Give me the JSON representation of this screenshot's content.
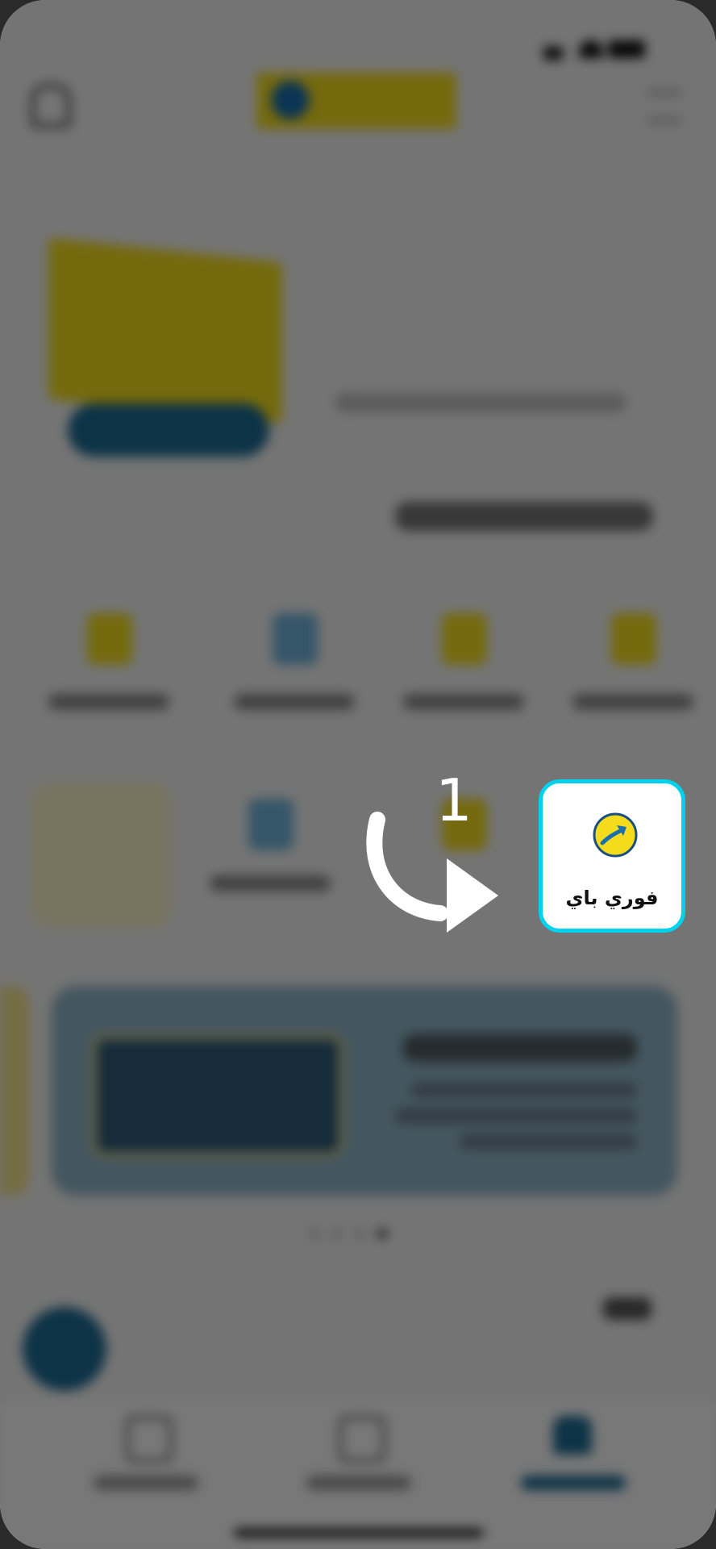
{
  "highlight": {
    "label": "فوري باي",
    "border_color": "#00d2ee",
    "icon": "fawry-pay-icon"
  },
  "step": {
    "number": "1",
    "icon": "curved-arrow-icon"
  },
  "colors": {
    "brand_yellow": "#f4dc1c",
    "brand_blue": "#1c6b93",
    "overlay": "rgba(0,0,0,0.52)"
  }
}
